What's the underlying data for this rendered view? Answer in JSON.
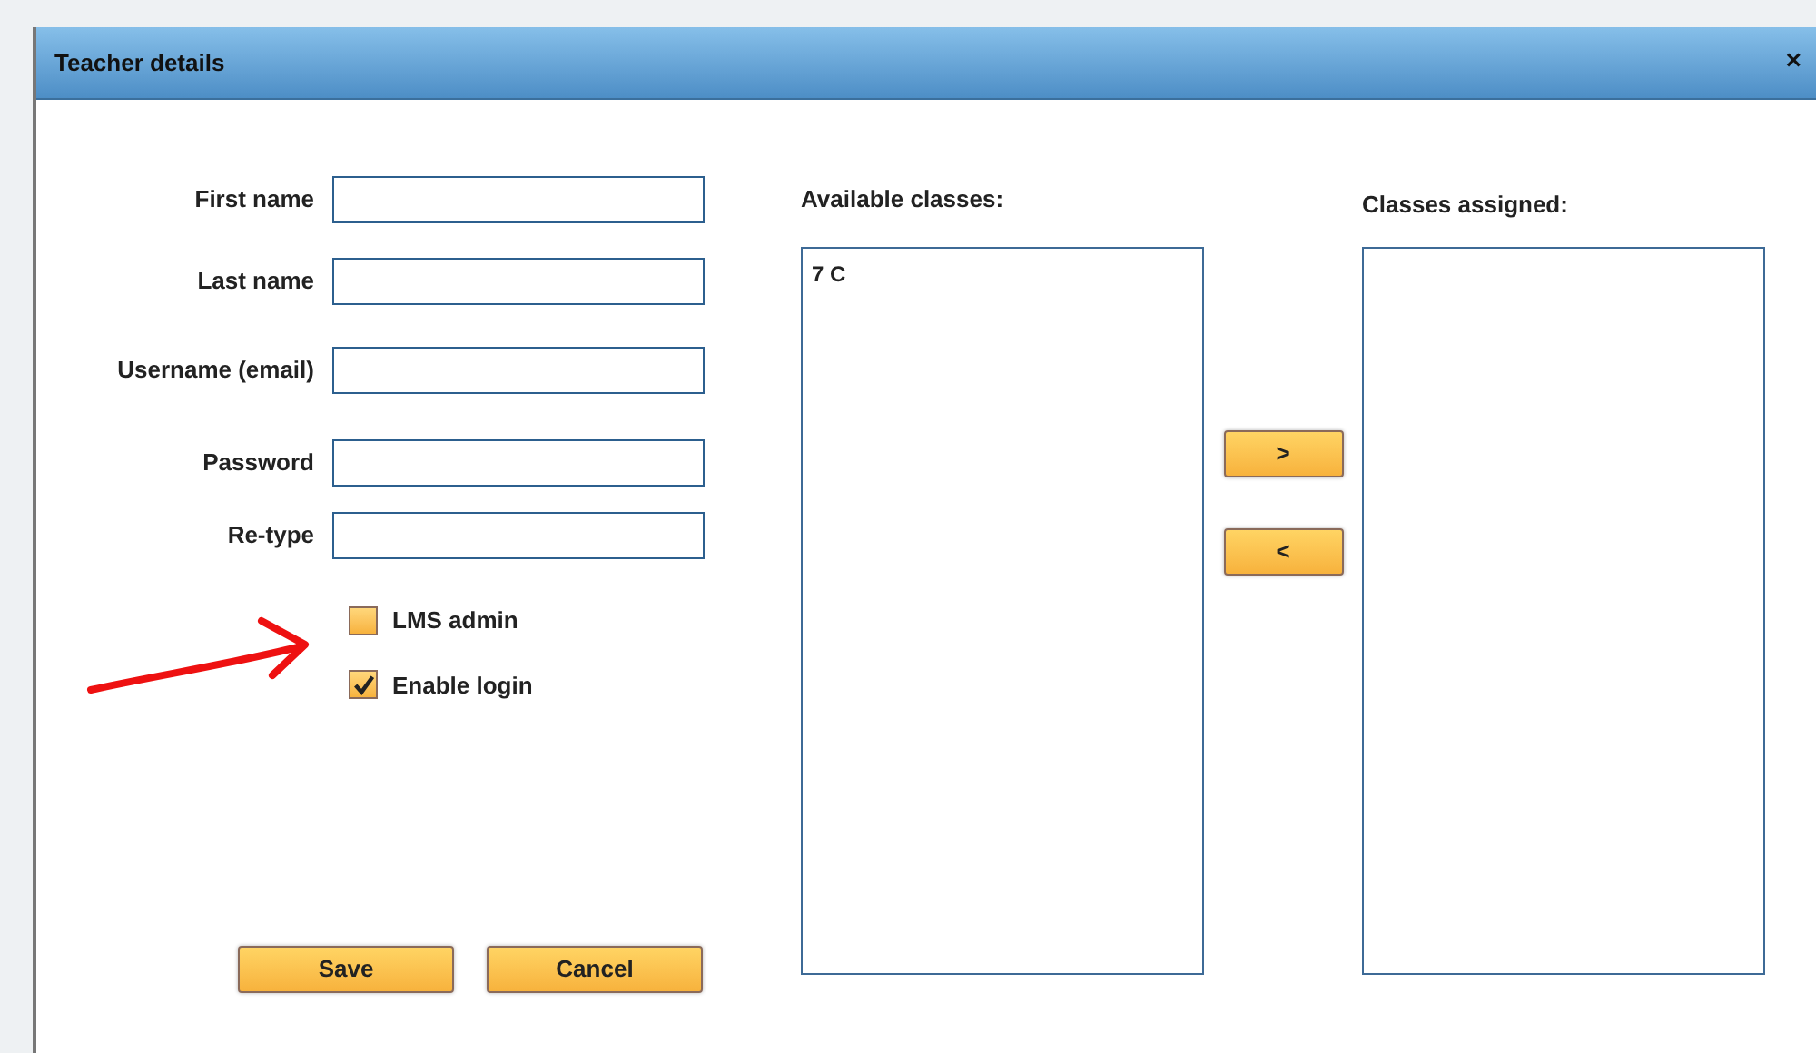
{
  "dialog": {
    "title": "Teacher details",
    "close": "×"
  },
  "fields": [
    {
      "label": "First name"
    },
    {
      "label": "Last name"
    },
    {
      "label": "Username (email)"
    },
    {
      "label": "Password"
    },
    {
      "label": "Re-type"
    }
  ],
  "checkboxes": [
    {
      "label": "LMS admin",
      "checked": false
    },
    {
      "label": "Enable login",
      "checked": true
    }
  ],
  "buttons": [
    "Save",
    "Cancel"
  ],
  "available": {
    "label": "Available classes:",
    "items": [
      "7 C"
    ]
  },
  "transfer_buttons": [
    ">",
    "<"
  ],
  "assigned": {
    "label": "Classes assigned:"
  }
}
